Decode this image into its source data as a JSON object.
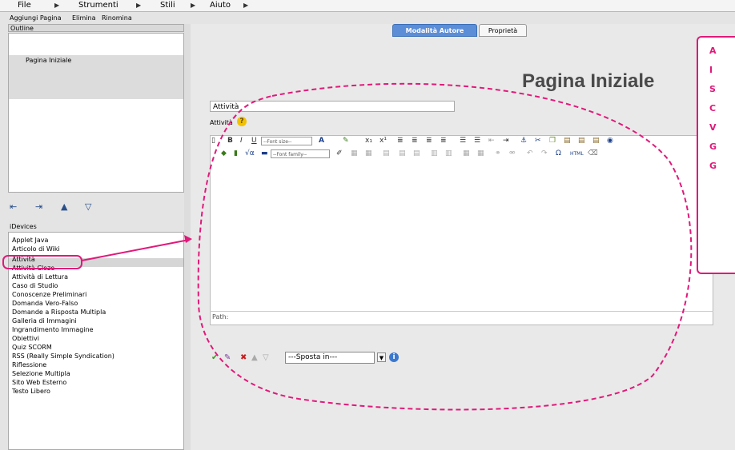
{
  "menubar": {
    "file": "File",
    "tools": "Strumenti",
    "styles": "Stili",
    "help": "Aiuto"
  },
  "left_toolbar": {
    "add_page": "Aggiungi Pagina",
    "delete": "Elimina",
    "rename": "Rinomina"
  },
  "outline": {
    "header": "Outline",
    "items": [
      "Pagina Iniziale"
    ]
  },
  "idevices": {
    "header": "iDevices",
    "items": [
      "Applet Java",
      "Articolo di Wiki",
      "Attività",
      "Attività Cloze",
      "Attività di Lettura",
      "Caso di Studio",
      "Conoscenze Preliminari",
      "Domanda Vero-Falso",
      "Domande a Risposta Multipla",
      "Galleria di Immagini",
      "Ingrandimento Immagine",
      "Obiettivi",
      "Quiz SCORM",
      "RSS (Really Simple Syndication)",
      "Riflessione",
      "Selezione Multipla",
      "Sito Web Esterno",
      "Testo Libero"
    ],
    "selected": "Attività"
  },
  "tabs": {
    "author": "Modalità Autore",
    "properties": "Proprietà"
  },
  "page_title": "Pagina Iniziale",
  "editor": {
    "title_value": "Attività",
    "field_label": "Attività",
    "help_glyph": "?",
    "font_size": "--Font size--",
    "font_family": "--Font family--",
    "path_label": "Path:"
  },
  "actions": {
    "move_placeholder": "---Sposta in---",
    "info_glyph": "i"
  },
  "callout": {
    "letters": [
      "A",
      "I",
      "S",
      "C",
      "V",
      "G",
      "G"
    ],
    "color": "#e0197a"
  },
  "accent_color": "#5c8ed8"
}
